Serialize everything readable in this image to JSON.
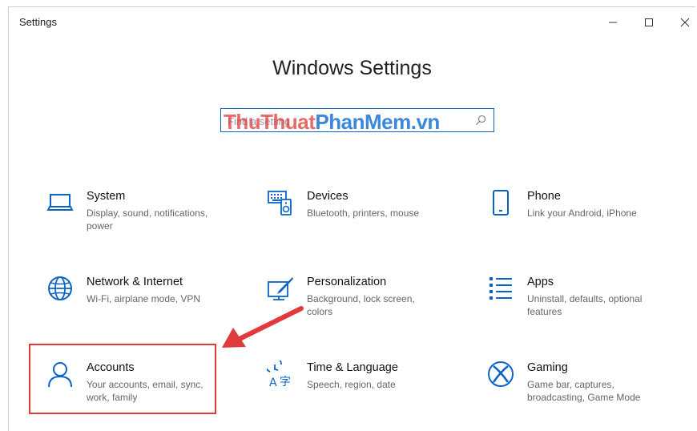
{
  "window": {
    "title": "Settings",
    "minimize_label": "–",
    "maximize_label": "□",
    "close_label": "✕"
  },
  "heading": "Windows Settings",
  "search": {
    "placeholder": "Find a setting",
    "icon": "search-icon"
  },
  "watermark": {
    "part1": "ThuThuat",
    "part2": "PhanMem.vn"
  },
  "accent_color": "#0a64c8",
  "highlight_color": "#e03a3a",
  "tiles": [
    {
      "title": "System",
      "desc": "Display, sound, notifications, power",
      "icon": "laptop-icon"
    },
    {
      "title": "Devices",
      "desc": "Bluetooth, printers, mouse",
      "icon": "keyboard-speaker-icon"
    },
    {
      "title": "Phone",
      "desc": "Link your Android, iPhone",
      "icon": "phone-icon"
    },
    {
      "title": "Network & Internet",
      "desc": "Wi-Fi, airplane mode, VPN",
      "icon": "globe-icon"
    },
    {
      "title": "Personalization",
      "desc": "Background, lock screen, colors",
      "icon": "paint-brush-icon"
    },
    {
      "title": "Apps",
      "desc": "Uninstall, defaults, optional features",
      "icon": "apps-list-icon"
    },
    {
      "title": "Accounts",
      "desc": "Your accounts, email, sync, work, family",
      "icon": "person-icon"
    },
    {
      "title": "Time & Language",
      "desc": "Speech, region, date",
      "icon": "time-language-icon"
    },
    {
      "title": "Gaming",
      "desc": "Game bar, captures, broadcasting, Game Mode",
      "icon": "xbox-icon"
    }
  ]
}
